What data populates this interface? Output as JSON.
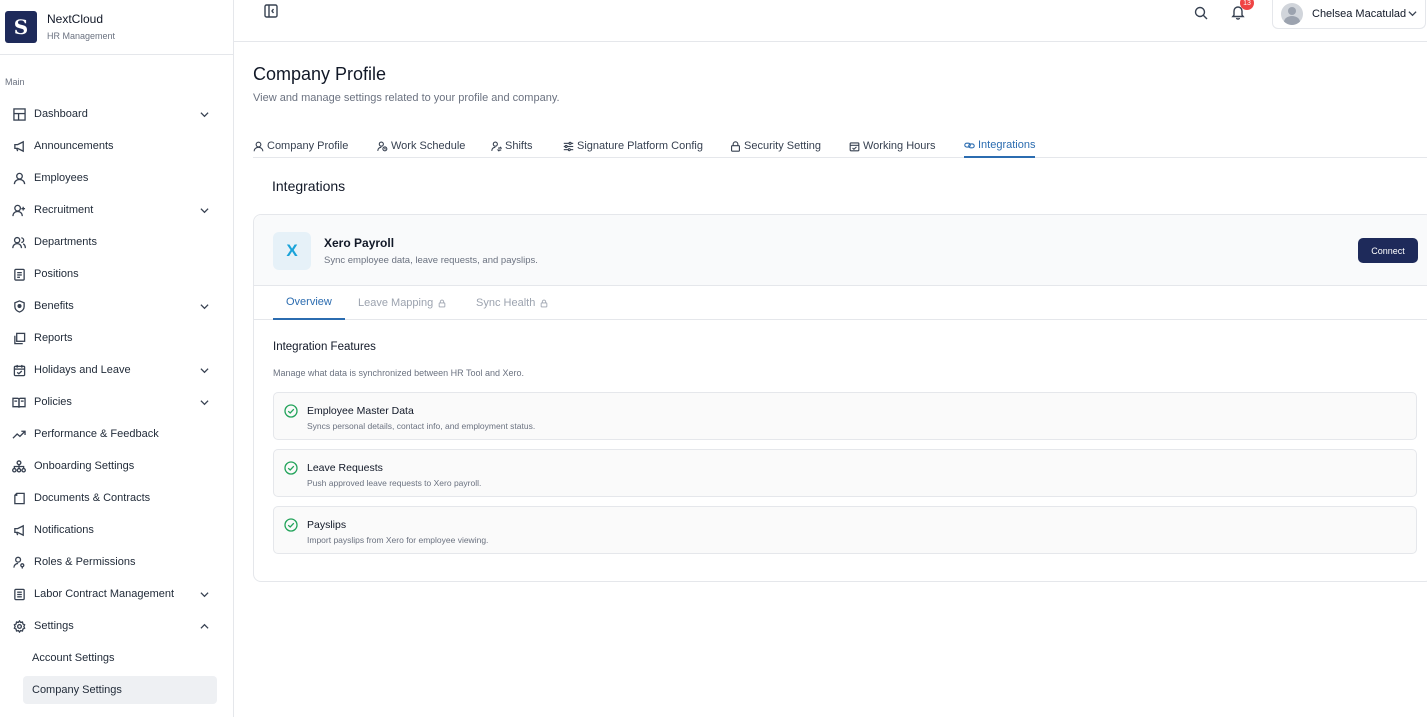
{
  "brand": {
    "name": "NextCloud",
    "subtitle": "HR Management",
    "logo_letter": "S"
  },
  "sidebar": {
    "section_label": "Main",
    "items": [
      {
        "label": "Dashboard",
        "icon": "grid-icon",
        "expandable": true
      },
      {
        "label": "Announcements",
        "icon": "megaphone-icon",
        "expandable": false
      },
      {
        "label": "Employees",
        "icon": "user-icon",
        "expandable": false
      },
      {
        "label": "Recruitment",
        "icon": "user-plus-icon",
        "expandable": true
      },
      {
        "label": "Departments",
        "icon": "users-icon",
        "expandable": false
      },
      {
        "label": "Positions",
        "icon": "clipboard-icon",
        "expandable": false
      },
      {
        "label": "Benefits",
        "icon": "shield-icon",
        "expandable": true
      },
      {
        "label": "Reports",
        "icon": "copy-icon",
        "expandable": false
      },
      {
        "label": "Holidays and Leave",
        "icon": "calendar-icon",
        "expandable": true
      },
      {
        "label": "Policies",
        "icon": "book-icon",
        "expandable": true
      },
      {
        "label": "Performance & Feedback",
        "icon": "trend-icon",
        "expandable": false
      },
      {
        "label": "Onboarding Settings",
        "icon": "network-icon",
        "expandable": false
      },
      {
        "label": "Documents & Contracts",
        "icon": "document-icon",
        "expandable": false
      },
      {
        "label": "Notifications",
        "icon": "megaphone-icon",
        "expandable": false
      },
      {
        "label": "Roles & Permissions",
        "icon": "user-key-icon",
        "expandable": false
      },
      {
        "label": "Labor Contract Management",
        "icon": "file-text-icon",
        "expandable": true
      },
      {
        "label": "Settings",
        "icon": "gear-icon",
        "expandable": true,
        "expanded": true
      }
    ],
    "sub_items": [
      {
        "label": "Account Settings",
        "active": false
      },
      {
        "label": "Company Settings",
        "active": true
      }
    ]
  },
  "topbar": {
    "notification_count": "13",
    "user_name": "Chelsea Macatulad"
  },
  "page": {
    "title": "Company Profile",
    "subtitle": "View and manage settings related to your profile and company."
  },
  "tabs": [
    {
      "label": "Company Profile",
      "icon": "user-icon"
    },
    {
      "label": "Work Schedule",
      "icon": "user-clock-icon"
    },
    {
      "label": "Shifts",
      "icon": "user-swap-icon"
    },
    {
      "label": "Signature Platform Config",
      "icon": "sliders-icon"
    },
    {
      "label": "Security Setting",
      "icon": "lock-icon"
    },
    {
      "label": "Working Hours",
      "icon": "calendar-check-icon"
    },
    {
      "label": "Integrations",
      "icon": "link-icon",
      "active": true
    }
  ],
  "integrations": {
    "section_title": "Integrations",
    "provider": {
      "logo_letter": "X",
      "name": "Xero Payroll",
      "description": "Sync employee data, leave requests, and payslips.",
      "connect_label": "Connect"
    },
    "subtabs": [
      {
        "label": "Overview",
        "active": true,
        "locked": false
      },
      {
        "label": "Leave Mapping",
        "active": false,
        "locked": true
      },
      {
        "label": "Sync Health",
        "active": false,
        "locked": true
      }
    ],
    "features_title": "Integration Features",
    "features_subtitle": "Manage what data is synchronized between HR Tool and Xero.",
    "features": [
      {
        "name": "Employee Master Data",
        "description": "Syncs personal details, contact info, and employment status."
      },
      {
        "name": "Leave Requests",
        "description": "Push approved leave requests to Xero payroll."
      },
      {
        "name": "Payslips",
        "description": "Import payslips from Xero for employee viewing."
      }
    ]
  },
  "colors": {
    "brand": "#1e2a5a",
    "accent": "#2b6cb0",
    "success": "#22a35a",
    "badge": "#ef4444",
    "xero": "#1aa3d9"
  }
}
